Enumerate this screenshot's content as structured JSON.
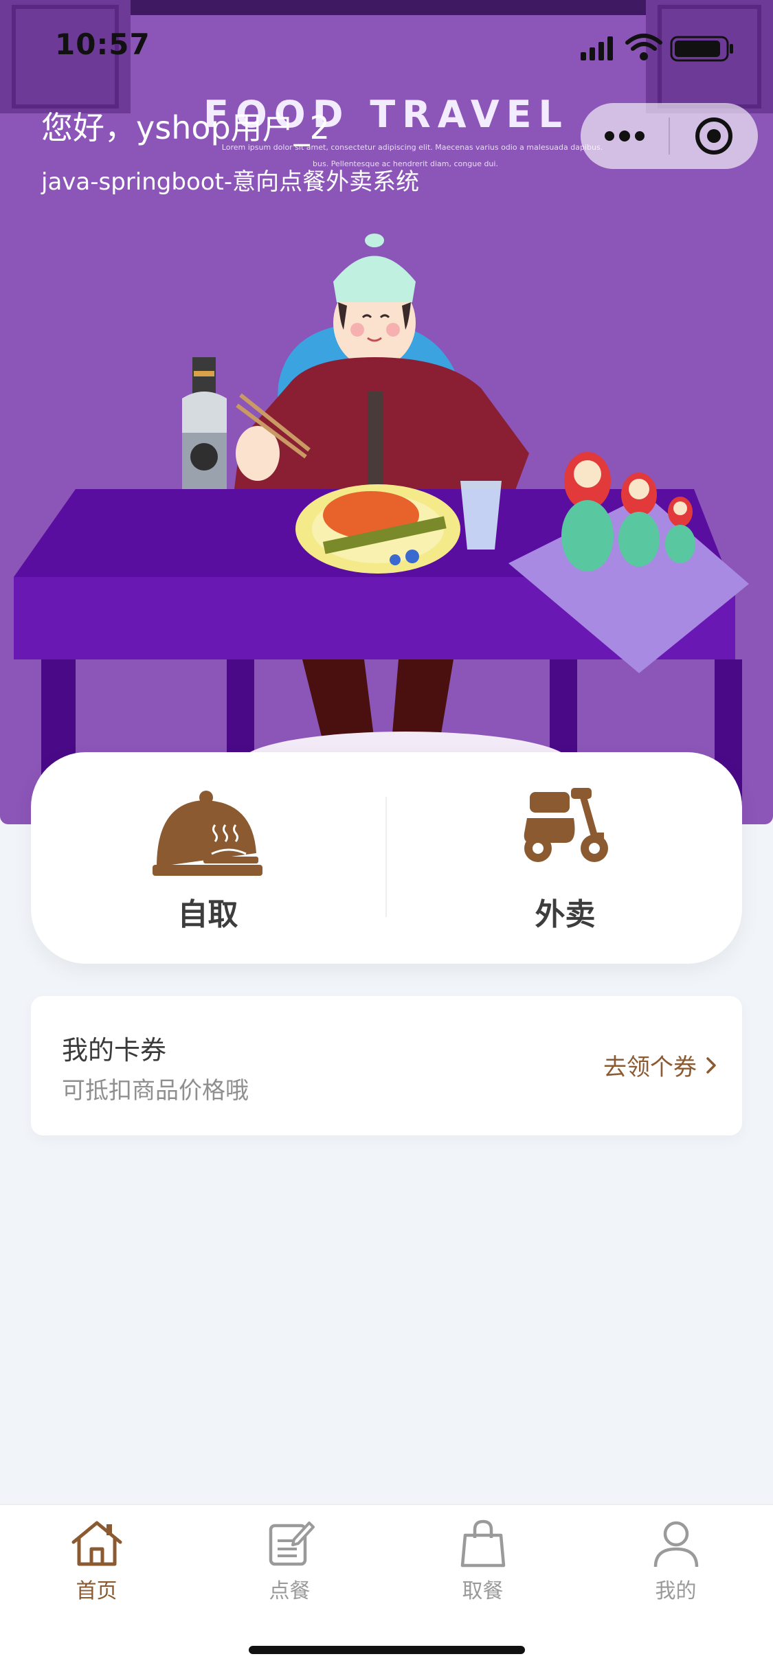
{
  "status_bar": {
    "time": "10:57"
  },
  "header": {
    "greeting": "您好，yshop用户_2",
    "subtitle": "java-springboot-意向点餐外卖系统"
  },
  "banner": {
    "heading": "FOOD TRAVEL",
    "lorem_line1": "Lorem ipsum dolor sit amet, consectetur adipiscing elit. Maecenas varius odio a malesuada dapibus.",
    "lorem_line2": "bus. Pellentesque ac hendrerit diam, congue dui."
  },
  "capsule": {
    "more_icon": "more-dots-icon",
    "target_icon": "target-icon"
  },
  "order_options": [
    {
      "label": "自取",
      "icon": "cloche-dish-icon"
    },
    {
      "label": "外卖",
      "icon": "scooter-icon"
    }
  ],
  "coupon": {
    "title": "我的卡券",
    "description": "可抵扣商品价格哦",
    "action": "去领个券"
  },
  "tabbar": {
    "tabs": [
      {
        "label": "首页",
        "icon": "home-icon",
        "active": true
      },
      {
        "label": "点餐",
        "icon": "order-edit-icon",
        "active": false
      },
      {
        "label": "取餐",
        "icon": "shopping-bag-icon",
        "active": false
      },
      {
        "label": "我的",
        "icon": "profile-icon",
        "active": false
      }
    ]
  },
  "colors": {
    "accent": "#8b5a30",
    "banner_bg": "#8b53b6",
    "table": "#5a0ea0",
    "page_bg": "#f1f5f9"
  }
}
